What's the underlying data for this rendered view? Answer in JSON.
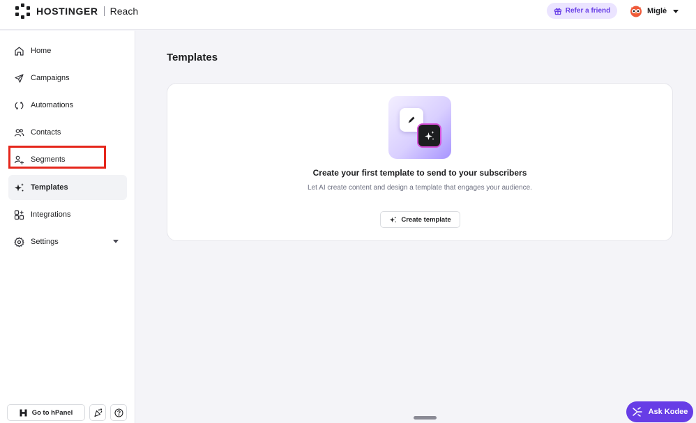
{
  "header": {
    "brand": "HOSTINGER",
    "product": "Reach",
    "refer_label": "Refer a friend",
    "user_name": "Miglė"
  },
  "sidebar": {
    "items": [
      {
        "label": "Home",
        "icon": "home-icon"
      },
      {
        "label": "Campaigns",
        "icon": "send-icon"
      },
      {
        "label": "Automations",
        "icon": "refresh-icon"
      },
      {
        "label": "Contacts",
        "icon": "users-icon"
      },
      {
        "label": "Segments",
        "icon": "user-plus-icon"
      },
      {
        "label": "Templates",
        "icon": "sparkles-icon",
        "active": true
      },
      {
        "label": "Integrations",
        "icon": "grid-plus-icon"
      },
      {
        "label": "Settings",
        "icon": "gear-icon"
      }
    ],
    "hpanel_label": "Go to hPanel"
  },
  "main": {
    "title": "Templates",
    "empty_state": {
      "heading": "Create your first template to send to your subscribers",
      "description": "Let AI create content and design a template that engages your audience.",
      "button_label": "Create template"
    }
  },
  "assistant": {
    "label": "Ask Kodee"
  },
  "colors": {
    "accent": "#673de6",
    "accent_light": "#ebe4ff",
    "highlight": "#e5261b",
    "background": "#f4f4f8"
  }
}
